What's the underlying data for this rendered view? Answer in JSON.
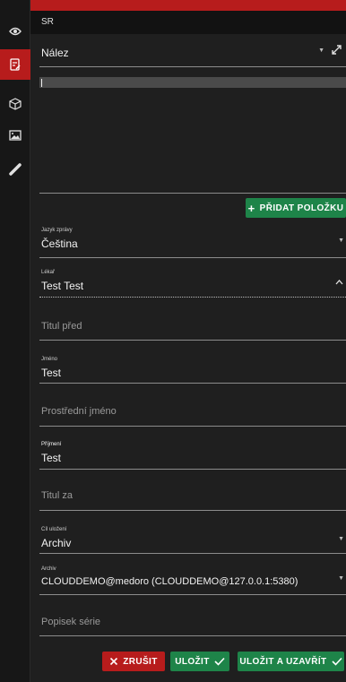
{
  "window": {
    "title": "SR"
  },
  "section": {
    "label": "Nález"
  },
  "actions": {
    "add_item": "PŘIDAT POLOŽKU"
  },
  "fields": {
    "language": {
      "label": "Jazyk zprávy",
      "value": "Čeština"
    },
    "doctor": {
      "label": "Lékař",
      "value": "Test Test"
    },
    "title_before": {
      "placeholder": "Titul před"
    },
    "first_name": {
      "label": "Jméno",
      "value": "Test"
    },
    "middle_name": {
      "placeholder": "Prostřední jméno"
    },
    "last_name": {
      "label": "Příjmení",
      "value": "Test"
    },
    "title_after": {
      "placeholder": "Titul za"
    },
    "target": {
      "label": "Cíl uložení",
      "value": "Archiv"
    },
    "archive": {
      "label": "Archiv",
      "value": "CLOUDDEMO@medoro (CLOUDDEMO@127.0.0.1:5380)"
    },
    "series_description": {
      "placeholder": "Popisek série"
    }
  },
  "footer": {
    "cancel": "ZRUŠIT",
    "save": "ULOŽIT",
    "save_close": "ULOŽIT A UZAVŘÍT"
  },
  "icons": [
    "eye-icon",
    "report-edit-icon",
    "cube-icon",
    "image-icon",
    "ruler-icon",
    "chevron-down-icon",
    "chevron-up-icon",
    "expand-icon",
    "plus-icon",
    "close-icon",
    "check-icon"
  ],
  "colors": {
    "accent_red": "#b71c1c",
    "accent_green": "#1e8449",
    "background": "#1f1f1f",
    "sidebar": "#171717"
  }
}
